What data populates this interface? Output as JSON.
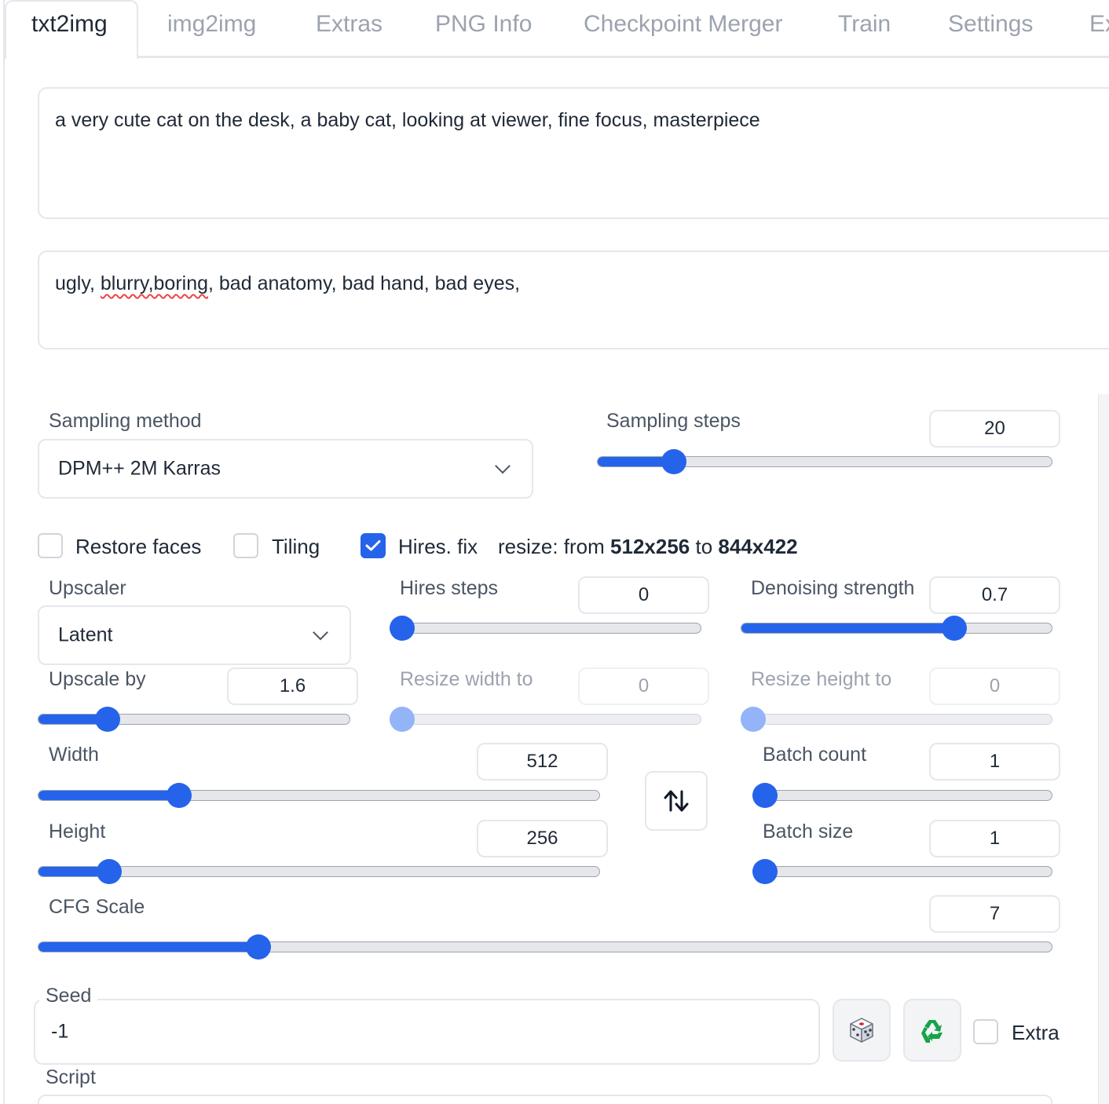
{
  "tabs": [
    {
      "label": "txt2img",
      "active": true
    },
    {
      "label": "img2img"
    },
    {
      "label": "Extras"
    },
    {
      "label": "PNG Info"
    },
    {
      "label": "Checkpoint Merger"
    },
    {
      "label": "Train"
    },
    {
      "label": "Settings"
    },
    {
      "label": "Ex"
    }
  ],
  "prompt": "a very cute cat on the desk, a baby cat, looking at viewer, fine focus, masterpiece",
  "negative_prompt": {
    "before": "ugly, ",
    "misspelled": "blurry,boring",
    "after": ", bad anatomy, bad hand, bad eyes,"
  },
  "sampling_method": {
    "label": "Sampling method",
    "value": "DPM++ 2M Karras"
  },
  "sampling_steps": {
    "label": "Sampling steps",
    "value": "20",
    "fraction": 0.15
  },
  "checkboxes": {
    "restore_faces": {
      "label": "Restore faces",
      "checked": false
    },
    "tiling": {
      "label": "Tiling",
      "checked": false
    },
    "hires_fix": {
      "label": "Hires. fix",
      "checked": true
    }
  },
  "resize_hint": {
    "prefix": "resize: from ",
    "from": "512x256",
    "middle": " to ",
    "to": "844x422"
  },
  "upscaler": {
    "label": "Upscaler",
    "value": "Latent"
  },
  "hires_steps": {
    "label": "Hires steps",
    "value": "0",
    "fraction": 0.0
  },
  "denoising_strength": {
    "label": "Denoising strength",
    "value": "0.7",
    "fraction": 0.7
  },
  "upscale_by": {
    "label": "Upscale by",
    "value": "1.6",
    "fraction": 0.2
  },
  "resize_width": {
    "label": "Resize width to",
    "value": "0",
    "fraction": 0.0,
    "disabled": true
  },
  "resize_height": {
    "label": "Resize height to",
    "value": "0",
    "fraction": 0.0,
    "disabled": true
  },
  "width": {
    "label": "Width",
    "value": "512",
    "fraction": 0.24
  },
  "height": {
    "label": "Height",
    "value": "256",
    "fraction": 0.11
  },
  "swap_icon": "swap-vertical-arrows-icon",
  "batch_count": {
    "label": "Batch count",
    "value": "1",
    "fraction": 0.0
  },
  "batch_size": {
    "label": "Batch size",
    "value": "1",
    "fraction": 0.0
  },
  "cfg_scale": {
    "label": "CFG Scale",
    "value": "7",
    "fraction": 0.21
  },
  "seed": {
    "label": "Seed",
    "value": "-1",
    "random_icon": "dice-icon",
    "reuse_icon": "recycle-icon",
    "extra_label": "Extra",
    "extra_checked": false
  },
  "script": {
    "label": "Script"
  },
  "colors": {
    "accent": "#2563eb",
    "border": "#e5e7eb",
    "muted_text": "#9ca3af"
  }
}
